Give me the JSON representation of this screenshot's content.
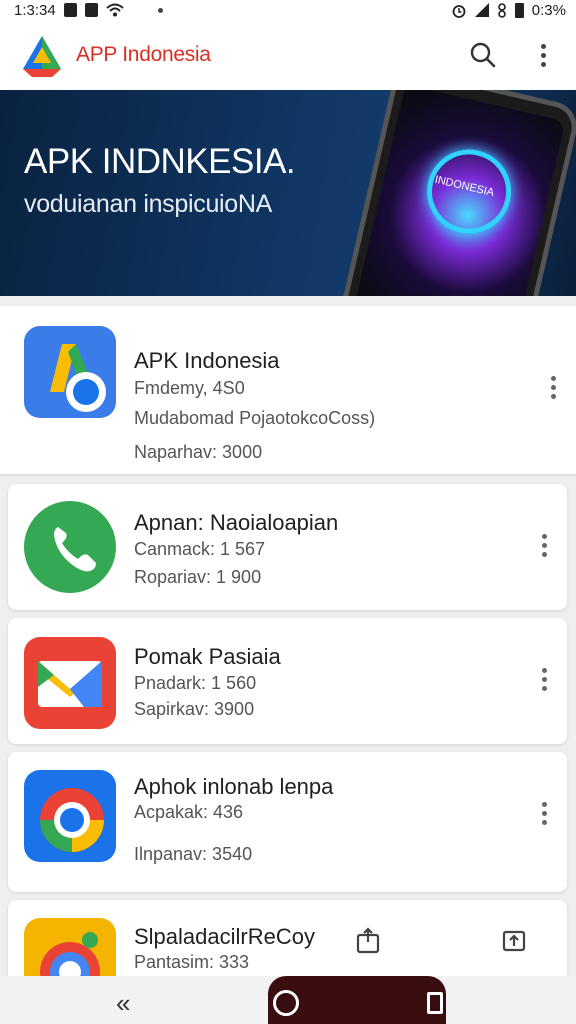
{
  "status_bar": {
    "time": "1:3:34",
    "battery": "0:3%"
  },
  "app_bar": {
    "title": "APP Indonesia"
  },
  "banner": {
    "title": "APK INDNKESIA.",
    "subtitle": "voduianan inspicuioNA",
    "phone_label": "INDONESIA"
  },
  "apps": [
    {
      "name": "APK Indonesia",
      "line1": "Fmdemy, 4S0",
      "line2": "Mudabomad PojaotokcoCoss)",
      "line3": "Naparhav: 3000",
      "icon": "apk-indonesia-icon"
    },
    {
      "name": "Apnan: Naoialoapian",
      "line1": "Canmack: 1 567",
      "line2": "Ropariav: 1 900",
      "icon": "phone-icon"
    },
    {
      "name": "Pomak Pasiaia",
      "line1": "Pnadark: 1 560",
      "line2": "Sapirkav: 3900",
      "icon": "mail-icon"
    },
    {
      "name": "Aphok inlonab lenpa",
      "line1": "Acpakak: 436",
      "line2": "Ilnpanav: 3540",
      "icon": "browser-icon"
    },
    {
      "name": "SlpaladacilrReCoy",
      "line1": "Pantasim: 333",
      "icon": "camera-icon"
    }
  ],
  "colors": {
    "accent": "#d93025",
    "banner": "#0f3460",
    "card": "#ffffff",
    "background": "#eeeff1"
  }
}
